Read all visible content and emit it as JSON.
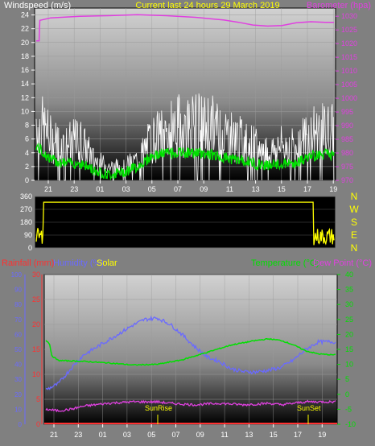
{
  "chart_data": [
    {
      "type": "line",
      "title": "Current last 24 hours 29 March 2019",
      "left_axis_label": "Windspeed (m/s)",
      "right_axis_label": "Barometer (hpa)",
      "x_tick_labels": [
        "21",
        "23",
        "01",
        "03",
        "05",
        "07",
        "09",
        "11",
        "13",
        "15",
        "17",
        "19"
      ],
      "left_ticks": [
        0,
        2,
        4,
        6,
        8,
        10,
        12,
        14,
        16,
        18,
        20,
        22,
        24
      ],
      "right_ticks": [
        970,
        975,
        980,
        985,
        990,
        995,
        1000,
        1005,
        1010,
        1015,
        1020,
        1025,
        1030
      ],
      "ylim_left": [
        0,
        25
      ],
      "ylim_right": [
        970,
        1033
      ],
      "colors": {
        "wind_gust": "#ffffff",
        "wind_avg": "#00e000",
        "barometer": "#e040e0",
        "title": "#ffff00"
      },
      "series": [
        {
          "key": "barometer",
          "axis": "right",
          "points": [
            [
              0,
              1021
            ],
            [
              0.2,
              1021
            ],
            [
              0.25,
              1028.5
            ],
            [
              1,
              1029.4
            ],
            [
              3,
              1030
            ],
            [
              5,
              1030.2
            ],
            [
              7,
              1030.6
            ],
            [
              9,
              1030.2
            ],
            [
              11,
              1029.6
            ],
            [
              13,
              1028.6
            ],
            [
              14,
              1027.8
            ],
            [
              15,
              1026.8
            ],
            [
              16,
              1026.4
            ],
            [
              17,
              1026.6
            ],
            [
              18,
              1027.6
            ],
            [
              19,
              1028
            ],
            [
              20,
              1027.8
            ],
            [
              20.6,
              1027.8
            ]
          ]
        },
        {
          "key": "wind_gust",
          "axis": "left",
          "points": [
            [
              0,
              9
            ],
            [
              1,
              6
            ],
            [
              2,
              5
            ],
            [
              3,
              6
            ],
            [
              4,
              3
            ],
            [
              5,
              2
            ],
            [
              6,
              2
            ],
            [
              7,
              3
            ],
            [
              8,
              6
            ],
            [
              9,
              7
            ],
            [
              10,
              8
            ],
            [
              11,
              8
            ],
            [
              12,
              8
            ],
            [
              13,
              7
            ],
            [
              14,
              6
            ],
            [
              15,
              5
            ],
            [
              16,
              4
            ],
            [
              17,
              5
            ],
            [
              18,
              5
            ],
            [
              19,
              7
            ],
            [
              20,
              7
            ],
            [
              20.6,
              7
            ]
          ]
        },
        {
          "key": "wind_avg",
          "axis": "left",
          "points": [
            [
              0,
              5
            ],
            [
              1,
              3
            ],
            [
              2,
              2.5
            ],
            [
              3,
              2.5
            ],
            [
              4,
              1.5
            ],
            [
              5,
              0.8
            ],
            [
              6,
              1.2
            ],
            [
              7,
              2
            ],
            [
              8,
              3.5
            ],
            [
              9,
              4
            ],
            [
              10,
              4
            ],
            [
              11,
              4
            ],
            [
              12,
              3.8
            ],
            [
              13,
              3.3
            ],
            [
              14,
              3
            ],
            [
              15,
              2.5
            ],
            [
              16,
              2.2
            ],
            [
              17,
              2.3
            ],
            [
              18,
              2.5
            ],
            [
              19,
              3.5
            ],
            [
              20,
              3.8
            ],
            [
              20.6,
              3.8
            ]
          ]
        }
      ]
    },
    {
      "type": "line",
      "left_ticks": [
        0,
        90,
        180,
        270,
        360
      ],
      "direction_labels": [
        "N",
        "W",
        "S",
        "E",
        "N"
      ],
      "ylim": [
        0,
        360
      ],
      "colors": {
        "direction": "#ffff00",
        "direction_labels": "#ffff00"
      },
      "series": [
        {
          "key": "wind_direction",
          "points": [
            [
              0,
              20
            ],
            [
              0.45,
              20
            ],
            [
              0.5,
              320
            ],
            [
              19.2,
              320
            ],
            [
              19.25,
              40
            ],
            [
              20.6,
              40
            ]
          ]
        }
      ]
    },
    {
      "type": "line",
      "left_axis_label_rainfall": "Rainfall (mm)",
      "left_axis_label_humidity": "Humidity (%)",
      "left_axis_label_solar": "Solar",
      "right_axis_label_temperature": "Temperature (°C)",
      "right_axis_label_dewpoint": "Dew Point (°C)",
      "x_tick_labels": [
        "21",
        "23",
        "01",
        "03",
        "05",
        "07",
        "09",
        "11",
        "13",
        "15",
        "17",
        "19"
      ],
      "rainfall_ticks": [
        0,
        5,
        10,
        15,
        20,
        25,
        30
      ],
      "humidity_ticks": [
        0,
        10,
        20,
        30,
        40,
        50,
        60,
        70,
        80,
        90,
        100
      ],
      "temperature_ticks": [
        -10,
        -5,
        0,
        5,
        10,
        15,
        20,
        25,
        30,
        35,
        40
      ],
      "ylim_humidity": [
        0,
        100
      ],
      "ylim_temperature": [
        -10,
        40
      ],
      "annotations": [
        "SunRise",
        "SunSet"
      ],
      "colors": {
        "rainfall": "#ff3030",
        "humidity": "#6a6aff",
        "solar": "#ffff00",
        "temperature": "#00e000",
        "dewpoint": "#e040e0",
        "sun_marker": "#ffff00"
      },
      "series": [
        {
          "key": "temperature",
          "points": [
            [
              0,
              18
            ],
            [
              0.3,
              17
            ],
            [
              0.45,
              13
            ],
            [
              1,
              11.3
            ],
            [
              3,
              11
            ],
            [
              5,
              10.5
            ],
            [
              7,
              9.8
            ],
            [
              9,
              10
            ],
            [
              11,
              11.5
            ],
            [
              13,
              14
            ],
            [
              15,
              16.5
            ],
            [
              17,
              18
            ],
            [
              18,
              18.5
            ],
            [
              19,
              18
            ],
            [
              20,
              16.5
            ],
            [
              21,
              14.5
            ],
            [
              22,
              13.5
            ],
            [
              23,
              13.2
            ],
            [
              23.4,
              13.2
            ]
          ]
        },
        {
          "key": "dewpoint",
          "points": [
            [
              0,
              -5
            ],
            [
              1,
              -5.5
            ],
            [
              2,
              -5
            ],
            [
              3,
              -4
            ],
            [
              5,
              -3
            ],
            [
              7,
              -2.5
            ],
            [
              9,
              -2.5
            ],
            [
              10,
              -3
            ],
            [
              12,
              -3.5
            ],
            [
              14,
              -3
            ],
            [
              16,
              -3.5
            ],
            [
              18,
              -3
            ],
            [
              19,
              -3.5
            ],
            [
              20,
              -3
            ],
            [
              21,
              -2.5
            ],
            [
              22,
              -2.5
            ],
            [
              23.4,
              -2.5
            ]
          ]
        },
        {
          "key": "humidity",
          "points": [
            [
              0,
              23
            ],
            [
              1,
              27
            ],
            [
              2,
              37
            ],
            [
              3,
              46
            ],
            [
              5,
              56
            ],
            [
              7,
              66
            ],
            [
              8,
              70
            ],
            [
              9,
              71
            ],
            [
              10,
              67
            ],
            [
              11,
              60
            ],
            [
              12,
              52
            ],
            [
              13,
              45
            ],
            [
              14,
              42
            ],
            [
              15,
              37
            ],
            [
              16,
              35
            ],
            [
              17,
              35
            ],
            [
              18,
              36
            ],
            [
              19,
              38
            ],
            [
              20,
              43
            ],
            [
              21,
              50
            ],
            [
              22,
              55
            ],
            [
              23.4,
              55
            ]
          ]
        }
      ]
    }
  ]
}
